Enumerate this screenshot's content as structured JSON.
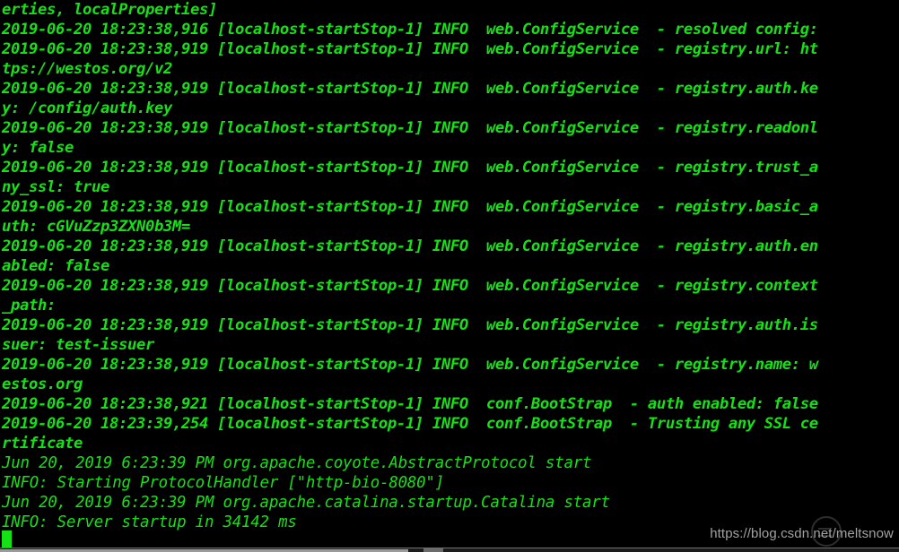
{
  "terminal": {
    "background_color": "#000000",
    "foreground_color": "#16e016",
    "cursor": {
      "name": "block-cursor",
      "color": "#16e016"
    },
    "lines": [
      {
        "text": "erties, localProperties]",
        "weight": "bold"
      },
      {
        "text": "2019-06-20 18:23:38,916 [localhost-startStop-1] INFO  web.ConfigService  - resolved config:",
        "weight": "bold"
      },
      {
        "text": "2019-06-20 18:23:38,919 [localhost-startStop-1] INFO  web.ConfigService  - registry.url: ht",
        "weight": "bold"
      },
      {
        "text": "tps://westos.org/v2",
        "weight": "bold"
      },
      {
        "text": "2019-06-20 18:23:38,919 [localhost-startStop-1] INFO  web.ConfigService  - registry.auth.ke",
        "weight": "bold"
      },
      {
        "text": "y: /config/auth.key",
        "weight": "bold"
      },
      {
        "text": "2019-06-20 18:23:38,919 [localhost-startStop-1] INFO  web.ConfigService  - registry.readonl",
        "weight": "bold"
      },
      {
        "text": "y: false",
        "weight": "bold"
      },
      {
        "text": "2019-06-20 18:23:38,919 [localhost-startStop-1] INFO  web.ConfigService  - registry.trust_a",
        "weight": "bold"
      },
      {
        "text": "ny_ssl: true",
        "weight": "bold"
      },
      {
        "text": "2019-06-20 18:23:38,919 [localhost-startStop-1] INFO  web.ConfigService  - registry.basic_a",
        "weight": "bold"
      },
      {
        "text": "uth: cGVuZzp3ZXN0b3M=",
        "weight": "bold"
      },
      {
        "text": "2019-06-20 18:23:38,919 [localhost-startStop-1] INFO  web.ConfigService  - registry.auth.en",
        "weight": "bold"
      },
      {
        "text": "abled: false",
        "weight": "bold"
      },
      {
        "text": "2019-06-20 18:23:38,919 [localhost-startStop-1] INFO  web.ConfigService  - registry.context",
        "weight": "bold"
      },
      {
        "text": "_path:",
        "weight": "bold"
      },
      {
        "text": "2019-06-20 18:23:38,919 [localhost-startStop-1] INFO  web.ConfigService  - registry.auth.is",
        "weight": "bold"
      },
      {
        "text": "suer: test-issuer",
        "weight": "bold"
      },
      {
        "text": "2019-06-20 18:23:38,919 [localhost-startStop-1] INFO  web.ConfigService  - registry.name: w",
        "weight": "bold"
      },
      {
        "text": "estos.org",
        "weight": "bold"
      },
      {
        "text": "2019-06-20 18:23:38,921 [localhost-startStop-1] INFO  conf.BootStrap  - auth enabled: false",
        "weight": "bold"
      },
      {
        "text": "2019-06-20 18:23:39,254 [localhost-startStop-1] INFO  conf.BootStrap  - Trusting any SSL ce",
        "weight": "bold"
      },
      {
        "text": "rtificate",
        "weight": "bold"
      },
      {
        "text": "Jun 20, 2019 6:23:39 PM org.apache.coyote.AbstractProtocol start",
        "weight": "regular"
      },
      {
        "text": "INFO: Starting ProtocolHandler [\"http-bio-8080\"]",
        "weight": "regular"
      },
      {
        "text": "Jun 20, 2019 6:23:39 PM org.apache.catalina.startup.Catalina start",
        "weight": "regular"
      },
      {
        "text": "INFO: Server startup in 34142 ms",
        "weight": "regular"
      }
    ]
  },
  "watermark": {
    "text": "https://blog.csdn.net/meltsnow",
    "color": "#b9b9b9"
  }
}
